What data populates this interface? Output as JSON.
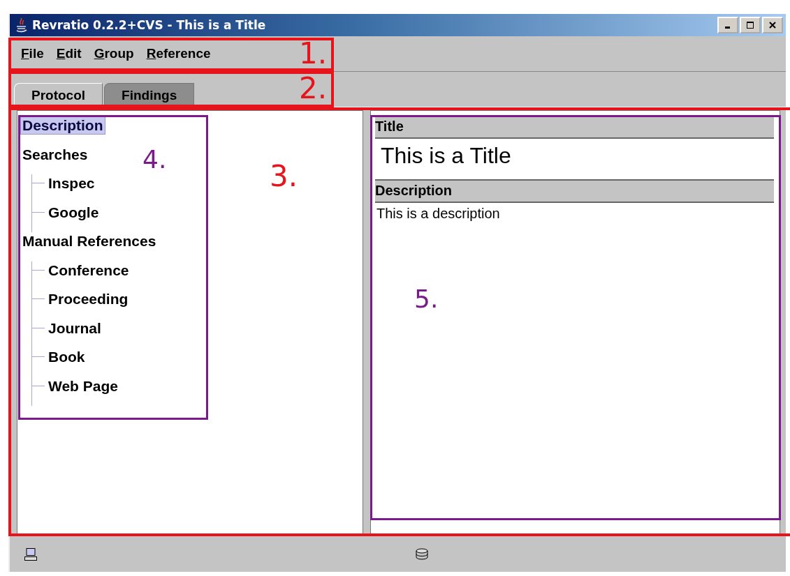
{
  "window": {
    "title": "Revratio 0.2.2+CVS - This is a Title"
  },
  "menu": [
    {
      "label": "File",
      "mnemonic_underlined": true
    },
    {
      "label": "Edit",
      "mnemonic_underlined": true
    },
    {
      "label": "Group",
      "mnemonic_underlined": true
    },
    {
      "label": "Reference",
      "mnemonic_underlined": true
    }
  ],
  "tabs": [
    {
      "label": "Protocol",
      "selected": true
    },
    {
      "label": "Findings",
      "selected": false
    }
  ],
  "tree": [
    {
      "label": "Description",
      "selected": true
    },
    {
      "label": "Searches",
      "selected": false,
      "children": [
        {
          "label": "Inspec",
          "selected": false
        },
        {
          "label": "Google",
          "selected": false
        }
      ]
    },
    {
      "label": "Manual References",
      "selected": false,
      "children": [
        {
          "label": "Conference",
          "selected": false
        },
        {
          "label": "Proceeding",
          "selected": false
        },
        {
          "label": "Journal",
          "selected": false
        },
        {
          "label": "Book",
          "selected": false
        },
        {
          "label": "Web Page",
          "selected": false
        }
      ]
    }
  ],
  "details": [
    {
      "heading": "Title",
      "value": "This is a Title",
      "kind": "title"
    },
    {
      "heading": "Description",
      "value": "This is a description",
      "kind": "text"
    }
  ],
  "annotations": [
    {
      "label": "1.",
      "color": "#e8141c"
    },
    {
      "label": "2.",
      "color": "#e8141c"
    },
    {
      "label": "3.",
      "color": "#e8141c"
    },
    {
      "label": "4.",
      "color": "#7b1a8a"
    },
    {
      "label": "5.",
      "color": "#7b1a8a"
    }
  ]
}
